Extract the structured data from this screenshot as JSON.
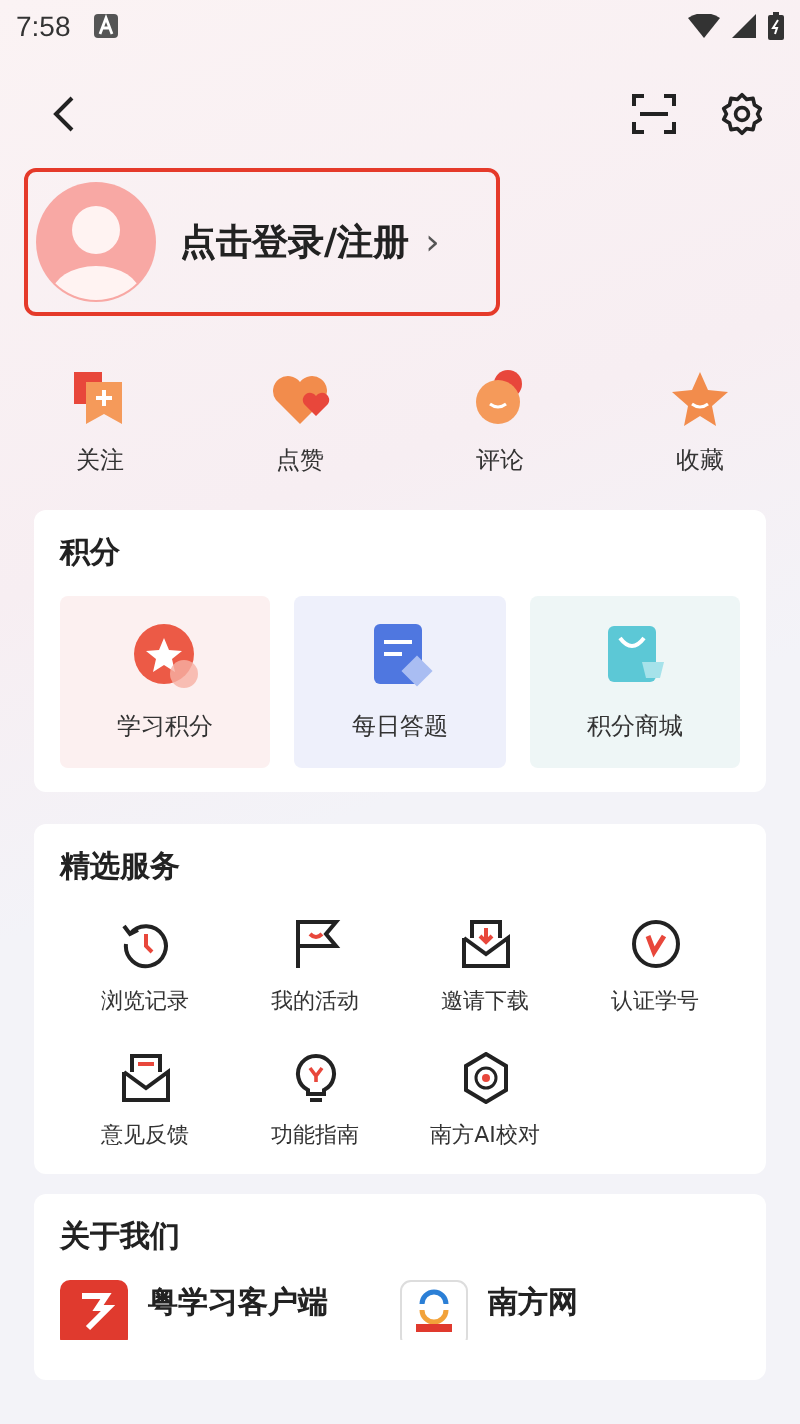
{
  "status_bar": {
    "time": "7:58"
  },
  "profile": {
    "login_text": "点击登录/注册",
    "chevron": "›"
  },
  "shortcuts": [
    {
      "label": "关注",
      "kind": "follow"
    },
    {
      "label": "点赞",
      "kind": "like"
    },
    {
      "label": "评论",
      "kind": "comment"
    },
    {
      "label": "收藏",
      "kind": "star"
    }
  ],
  "points": {
    "title": "积分",
    "items": [
      {
        "label": "学习积分",
        "kind": "study"
      },
      {
        "label": "每日答题",
        "kind": "quiz"
      },
      {
        "label": "积分商城",
        "kind": "shop"
      }
    ]
  },
  "services": {
    "title": "精选服务",
    "items": [
      {
        "label": "浏览记录",
        "kind": "history"
      },
      {
        "label": "我的活动",
        "kind": "flag"
      },
      {
        "label": "邀请下载",
        "kind": "download"
      },
      {
        "label": "认证学号",
        "kind": "verify"
      },
      {
        "label": "意见反馈",
        "kind": "feedback"
      },
      {
        "label": "功能指南",
        "kind": "bulb"
      },
      {
        "label": "南方AI校对",
        "kind": "ai"
      }
    ]
  },
  "about": {
    "title": "关于我们",
    "apps": [
      {
        "name": "粤学习客户端",
        "kind": "red"
      },
      {
        "name": "南方网",
        "kind": "white"
      }
    ]
  }
}
